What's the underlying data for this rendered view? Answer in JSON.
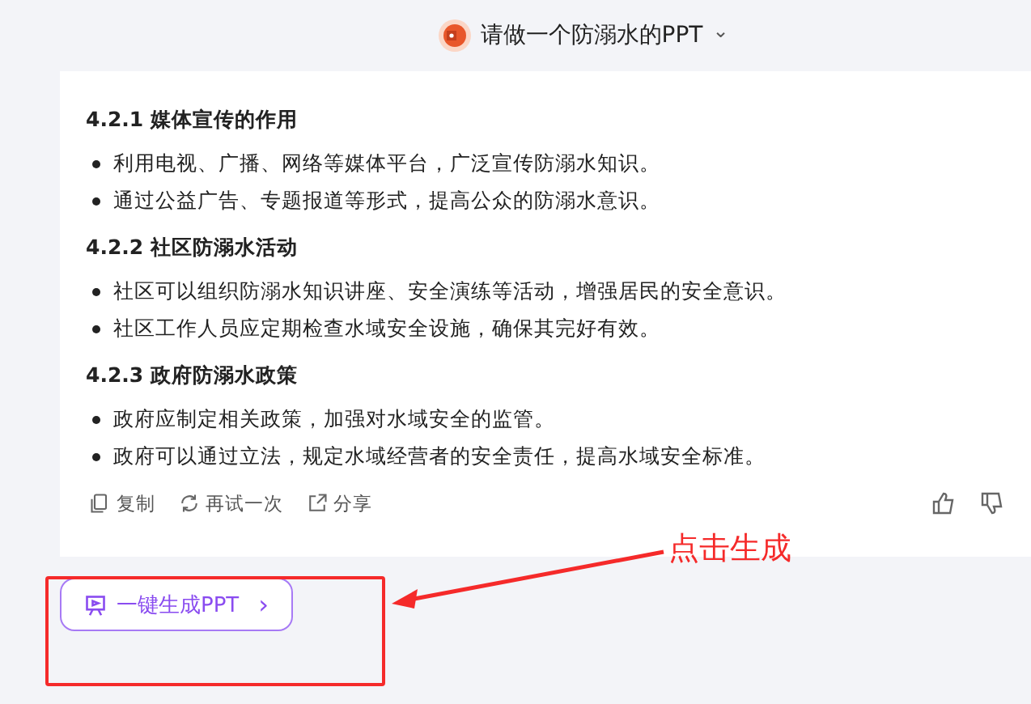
{
  "header": {
    "title": "请做一个防溺水的PPT",
    "dropdown": "⌄"
  },
  "sections": [
    {
      "heading": "4.2.1 媒体宣传的作用",
      "bullets": [
        "利用电视、广播、网络等媒体平台，广泛宣传防溺水知识。",
        "通过公益广告、专题报道等形式，提高公众的防溺水意识。"
      ]
    },
    {
      "heading": "4.2.2 社区防溺水活动",
      "bullets": [
        "社区可以组织防溺水知识讲座、安全演练等活动，增强居民的安全意识。",
        "社区工作人员应定期检查水域安全设施，确保其完好有效。"
      ]
    },
    {
      "heading": "4.2.3 政府防溺水政策",
      "bullets": [
        "政府应制定相关政策，加强对水域安全的监管。",
        "政府可以通过立法，规定水域经营者的安全责任，提高水域安全标准。"
      ]
    }
  ],
  "actions": [
    {
      "kind": "copy",
      "label": "复制"
    },
    {
      "kind": "retry",
      "label": "再试一次"
    },
    {
      "kind": "share",
      "label": "分享"
    }
  ],
  "generate_button": {
    "label": "一键生成PPT",
    "chevron": "›"
  },
  "annotation": {
    "text": "点击生成"
  }
}
